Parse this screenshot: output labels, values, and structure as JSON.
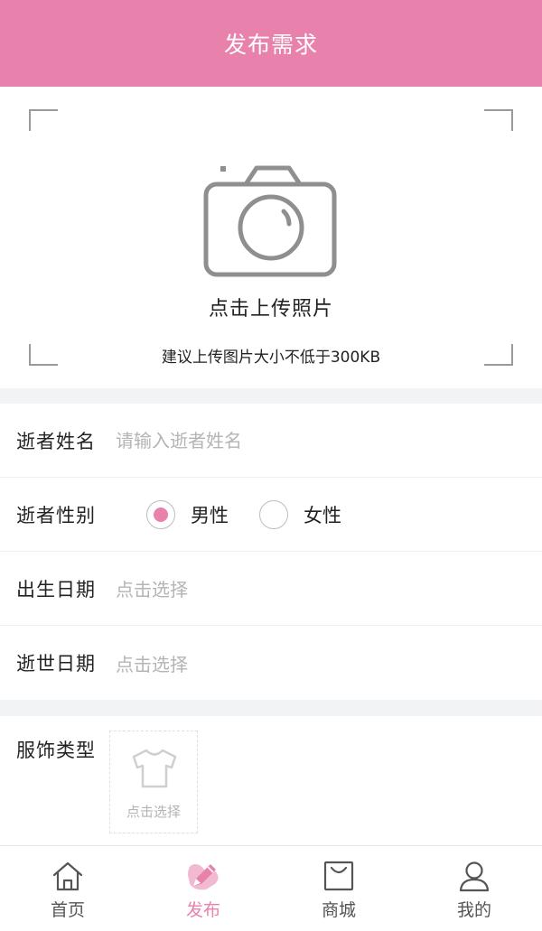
{
  "header": {
    "title": "发布需求"
  },
  "upload": {
    "label": "点击上传照片",
    "hint": "建议上传图片大小不低于300KB"
  },
  "form": {
    "name": {
      "label": "逝者姓名",
      "placeholder": "请输入逝者姓名"
    },
    "gender": {
      "label": "逝者性别",
      "options": [
        {
          "label": "男性",
          "selected": true
        },
        {
          "label": "女性",
          "selected": false
        }
      ]
    },
    "birth_date": {
      "label": "出生日期",
      "value": "点击选择"
    },
    "death_date": {
      "label": "逝世日期",
      "value": "点击选择"
    },
    "clothing": {
      "label": "服饰类型",
      "picker_label": "点击选择",
      "icon": "shirt-icon"
    }
  },
  "tabbar": {
    "items": [
      {
        "label": "首页",
        "icon": "home-icon",
        "active": false
      },
      {
        "label": "发布",
        "icon": "publish-pencil-icon",
        "active": true
      },
      {
        "label": "商城",
        "icon": "shopping-bag-icon",
        "active": false
      },
      {
        "label": "我的",
        "icon": "user-icon",
        "active": false
      }
    ]
  },
  "colors": {
    "accent": "#e882ac",
    "background": "#f2f3f5",
    "placeholder": "#b4b4b4"
  }
}
